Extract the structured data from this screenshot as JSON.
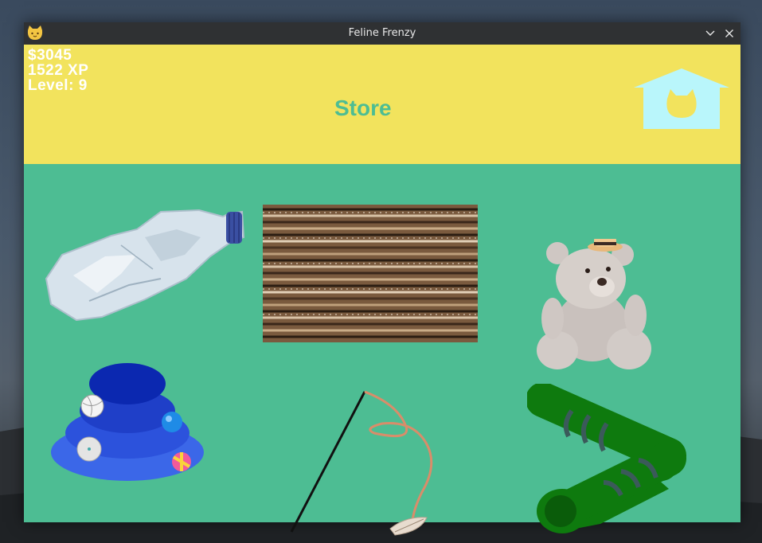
{
  "window": {
    "title": "Feline Frenzy",
    "app_icon": "cat-face-icon",
    "controls": [
      "minimize-icon",
      "close-icon"
    ]
  },
  "player": {
    "money": "$3045",
    "xp": "1522 XP",
    "level": "Level: 9"
  },
  "screen": {
    "title": "Store",
    "home_icon": "cat-house-icon"
  },
  "store_items": [
    {
      "id": "plastic-bottle",
      "icon": "plastic-bottle-icon"
    },
    {
      "id": "cardboard-scratcher",
      "icon": "cardboard-scratcher-icon"
    },
    {
      "id": "teddy-bear",
      "icon": "teddy-bear-icon"
    },
    {
      "id": "ball-tower",
      "icon": "ball-tower-icon"
    },
    {
      "id": "feather-wand",
      "icon": "feather-wand-icon"
    },
    {
      "id": "play-tunnel",
      "icon": "play-tunnel-icon"
    }
  ],
  "colors": {
    "header_bg": "#f2e35d",
    "content_bg": "#4dbd93",
    "title_text": "#4dbd93",
    "stats_text": "#ffffff",
    "home_icon": "#b9f6fb",
    "titlebar_bg": "#2f3133"
  }
}
